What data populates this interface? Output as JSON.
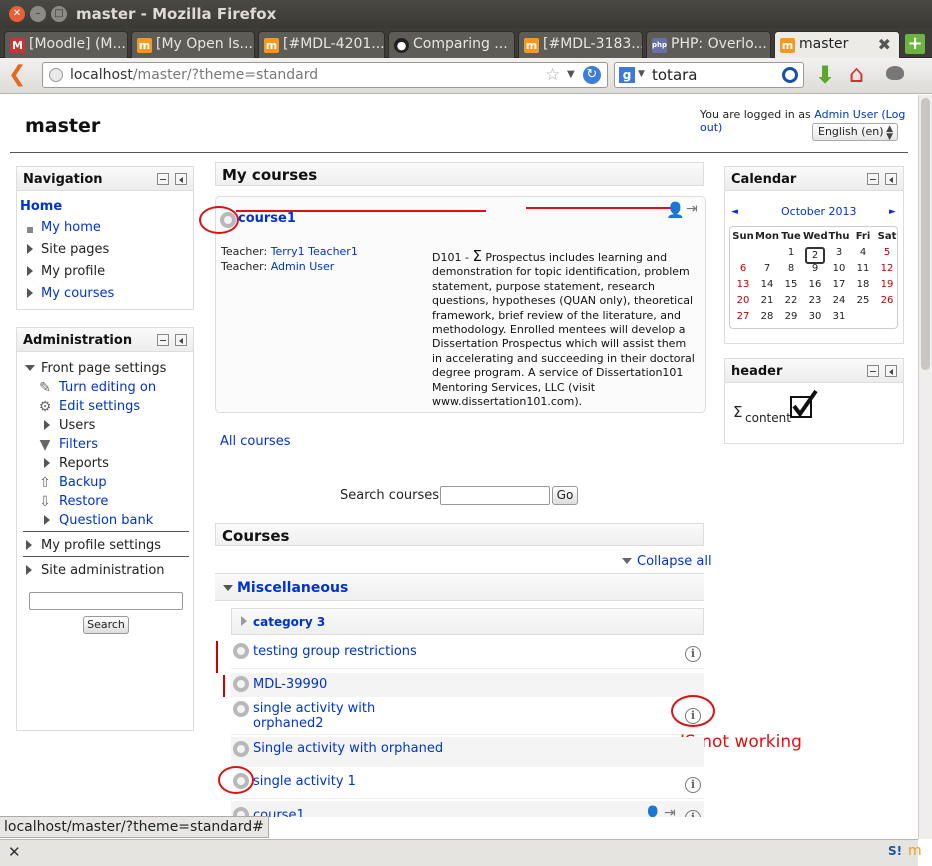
{
  "window": {
    "title": "master - Mozilla Firefox"
  },
  "tabs": [
    {
      "label": "[Moodle] (M...",
      "icon": "gmail-icon"
    },
    {
      "label": "[My Open Is...",
      "icon": "moodle-icon"
    },
    {
      "label": "[#MDL-4201...",
      "icon": "moodle-icon"
    },
    {
      "label": "Comparing ...",
      "icon": "github-icon"
    },
    {
      "label": "[#MDL-3183...",
      "icon": "moodle-icon"
    },
    {
      "label": "PHP: Overlo...",
      "icon": "php-icon"
    },
    {
      "label": "master",
      "icon": "moodle-icon",
      "active": true
    }
  ],
  "toolbar": {
    "url_host": "localhost",
    "url_path": "/master/?theme=standard",
    "search_value": "totara"
  },
  "site": {
    "name": "master",
    "login_prefix": "You are logged in as",
    "login_user": "Admin User",
    "logout": "(Log out)",
    "language": "English (en)"
  },
  "navigation": {
    "title": "Navigation",
    "home": "Home",
    "items": [
      "My home",
      "Site pages",
      "My profile",
      "My courses"
    ]
  },
  "administration": {
    "title": "Administration",
    "front_page_settings": "Front page settings",
    "items": [
      "Turn editing on",
      "Edit settings",
      "Users",
      "Filters",
      "Reports",
      "Backup",
      "Restore",
      "Question bank"
    ],
    "my_profile_settings": "My profile settings",
    "site_administration": "Site administration",
    "search_button": "Search"
  },
  "my_courses": {
    "title": "My courses",
    "course_name": "course1",
    "teacher_label": "Teacher:",
    "teachers": [
      "Terry1 Teacher1",
      "Admin User"
    ],
    "summary_prefix": "D101 -",
    "summary_sigma": "Σ",
    "summary": "Prospectus includes learning and demonstration for topic identification, problem statement, purpose statement, research questions, hypotheses (QUAN only), theoretical framework, brief review of the literature, and methodology. Enrolled mentees will develop a Dissertation Prospectus which will assist them in accelerating and succeeding in their doctoral degree program. A service of Dissertation101 Mentoring Services, LLC (visit www.dissertation101.com).",
    "all_courses": "All courses",
    "search_label": "Search courses:",
    "search_go": "Go"
  },
  "courses": {
    "title": "Courses",
    "collapse_all": "Collapse all",
    "category": "Miscellaneous",
    "subcategory": "category 3",
    "list": [
      "testing group restrictions",
      "MDL-39990",
      "single activity with orphaned2",
      "Single activity with orphaned",
      "single activity 1",
      "course1"
    ]
  },
  "annotation": {
    "js_note": "JS not working"
  },
  "calendar": {
    "title": "Calendar",
    "month": "October 2013",
    "prev": "◄",
    "next": "►",
    "days": [
      "Sun",
      "Mon",
      "Tue",
      "Wed",
      "Thu",
      "Fri",
      "Sat"
    ],
    "weeks": [
      [
        "",
        "",
        "1",
        "2",
        "3",
        "4",
        "5"
      ],
      [
        "6",
        "7",
        "8",
        "9",
        "10",
        "11",
        "12"
      ],
      [
        "13",
        "14",
        "15",
        "16",
        "17",
        "18",
        "19"
      ],
      [
        "20",
        "21",
        "22",
        "23",
        "24",
        "25",
        "26"
      ],
      [
        "27",
        "28",
        "29",
        "30",
        "31",
        "",
        ""
      ]
    ],
    "today": "2"
  },
  "header_block": {
    "title": "header",
    "sigma": "Σ",
    "content": "content"
  },
  "status": {
    "url": "localhost/master/?theme=standard#"
  },
  "colors": {
    "link": "#0033cc",
    "annotation_red": "#dd1111"
  }
}
